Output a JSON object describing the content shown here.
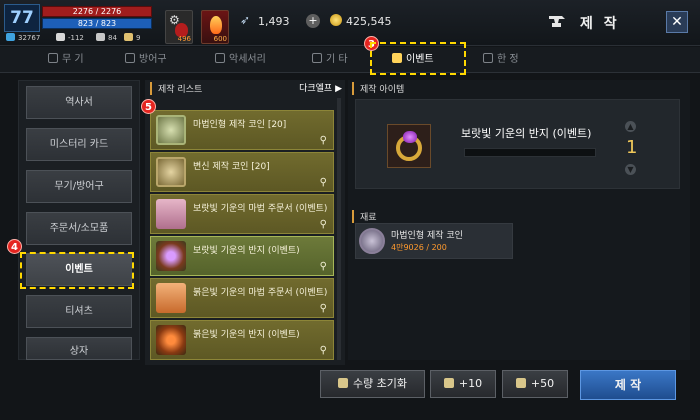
{
  "player": {
    "level": "77",
    "hp": "2276 / 2276",
    "mp": "823 / 823",
    "stats": [
      "32767",
      "-112",
      "84",
      "9"
    ]
  },
  "quick_slots": [
    {
      "icon": "potion-icon",
      "count": "496"
    },
    {
      "icon": "flame-icon",
      "count": "600"
    }
  ],
  "currency": {
    "feather": "1,493",
    "plus": "+",
    "gold": "425,545"
  },
  "header": {
    "title": "제 작",
    "close": "✕"
  },
  "tabs": [
    {
      "label": "무 기",
      "icon": "sword-icon"
    },
    {
      "label": "방어구",
      "icon": "armor-icon"
    },
    {
      "label": "악세서리",
      "icon": "necklace-icon"
    },
    {
      "label": "기 타",
      "icon": "box-icon"
    },
    {
      "label": "이벤트",
      "icon": "gift-icon",
      "active": true
    },
    {
      "label": "한 정",
      "icon": "clock-icon"
    }
  ],
  "categories": [
    {
      "label": "역사서"
    },
    {
      "label": "미스터리 카드"
    },
    {
      "label": "무기/방어구"
    },
    {
      "label": "주문서/소모품"
    },
    {
      "label": "이벤트",
      "active": true
    },
    {
      "label": "티셔츠"
    },
    {
      "label": "상자"
    }
  ],
  "craft_list": {
    "title": "제작 리스트",
    "filter": "다크엘프 ▶",
    "items": [
      {
        "name": "마법인형 제작 코인 [20]",
        "icon": "coin-icon"
      },
      {
        "name": "변신 제작 코인 [20]",
        "icon": "coin-icon"
      },
      {
        "name": "보랏빛 기운의 마법 주문서 (이벤트)",
        "icon": "scroll-icon"
      },
      {
        "name": "보랏빛 기운의 반지 (이벤트)",
        "icon": "ring-icon",
        "active": true
      },
      {
        "name": "붉은빛 기운의 마법 주문서 (이벤트)",
        "icon": "scroll-icon"
      },
      {
        "name": "붉은빛 기운의 반지 (이벤트)",
        "icon": "ring-icon"
      }
    ]
  },
  "craft_item": {
    "section_label": "제작 아이템",
    "name": "보랏빛 기운의 반지 (이벤트)",
    "quantity": "1"
  },
  "materials": {
    "section_label": "재료",
    "items": [
      {
        "name": "마법인형 제작 코인",
        "count": "4만9026 / 200"
      }
    ]
  },
  "bottom_buttons": {
    "reset": "수량 초기화",
    "plus10": "+10",
    "plus50": "+50",
    "make": "제 작"
  },
  "markers": [
    "3",
    "4",
    "5"
  ],
  "colors": {
    "accent_blue": "#2f6bb8",
    "highlight_yellow": "#ffd800",
    "marker_red": "#e52520",
    "list_item_olive": "#716b2e"
  }
}
